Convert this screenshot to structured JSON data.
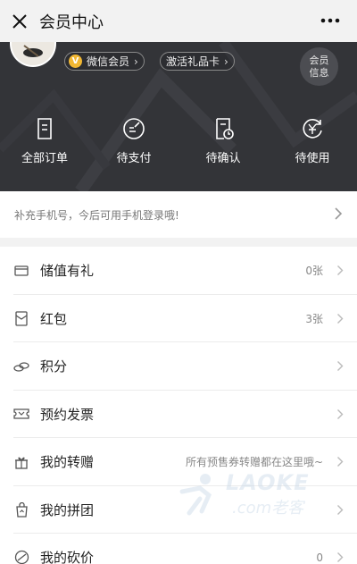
{
  "topbar": {
    "title": "会员中心",
    "close_icon": "close-icon",
    "more_icon": "more-icon"
  },
  "profile": {
    "membership_pill": "微信会员",
    "membership_pill_icon": "vip-badge-icon",
    "membership_pill_icon_text": "V",
    "gift_card_pill": "激活礼品卡",
    "member_info_button": [
      "会员",
      "信息"
    ]
  },
  "orders": [
    {
      "label": "全部订单",
      "icon": "document-icon"
    },
    {
      "label": "待支付",
      "icon": "edit-circle-icon"
    },
    {
      "label": "待确认",
      "icon": "clock-document-icon"
    },
    {
      "label": "待使用",
      "icon": "yen-cycle-icon"
    }
  ],
  "phone_tip": {
    "text": "补充手机号，今后可用手机登录哦!"
  },
  "menu": [
    {
      "label": "储值有礼",
      "value": "0张",
      "icon": "card-icon"
    },
    {
      "label": "红包",
      "value": "3张",
      "icon": "red-envelope-icon"
    },
    {
      "label": "积分",
      "value": "",
      "icon": "coins-icon"
    },
    {
      "label": "预约发票",
      "value": "",
      "icon": "ticket-icon"
    },
    {
      "label": "我的转赠",
      "value": "所有预售券转赠都在这里哦~",
      "icon": "gift-icon"
    },
    {
      "label": "我的拼团",
      "value": "",
      "icon": "group-bag-icon"
    },
    {
      "label": "我的砍价",
      "value": "0",
      "icon": "bargain-icon"
    }
  ],
  "watermark": {
    "brand": "LAOKE",
    "domain": ".com老客"
  },
  "colors": {
    "hero_bg": "#333438",
    "vip_gold": "#f1b733",
    "page_bg": "#f2f2f2"
  }
}
